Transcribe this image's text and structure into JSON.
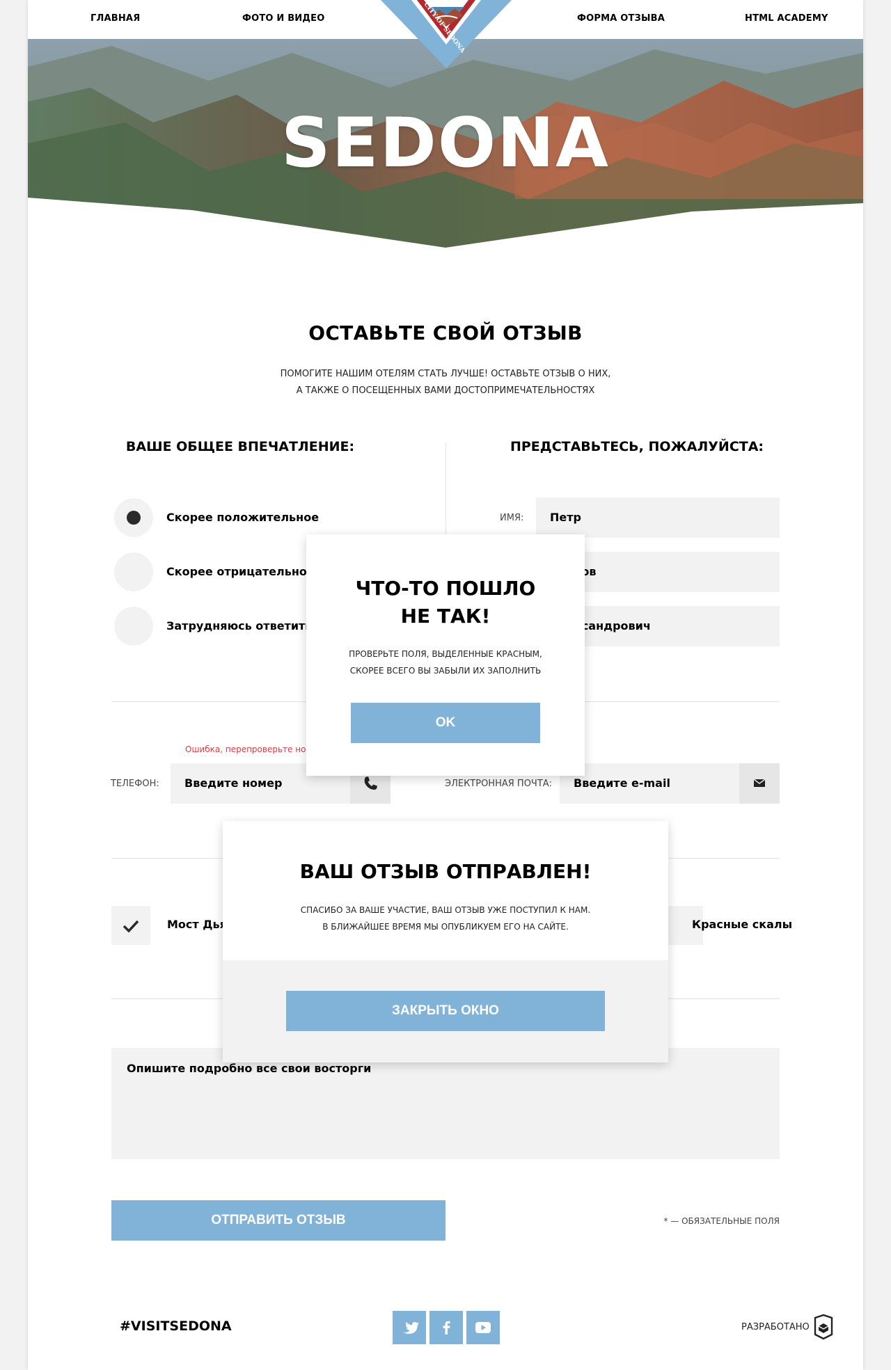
{
  "nav": {
    "items": [
      "ГЛАВНАЯ",
      "ФОТО И ВИДЕО",
      "ФОРМА ОТЗЫВА",
      "HTML ACADEMY"
    ],
    "logo_text": "CITY OF SEDONA"
  },
  "hero": {
    "title": "SEDONA"
  },
  "form": {
    "title": "ОСТАВЬТЕ СВОЙ ОТЗЫВ",
    "subtitle_line1": "ПОМОГИТЕ НАШИМ ОТЕЛЯМ СТАТЬ ЛУЧШЕ! ОСТАВЬТЕ ОТЗЫВ О НИХ,",
    "subtitle_line2": "А ТАКЖЕ О ПОСЕЩЕННЫХ ВАМИ ДОСТОПРИМЕЧАТЕЛЬНОСТЯХ",
    "impression": {
      "title": "ВАШЕ ОБЩЕЕ ВПЕЧАТЛЕНИЕ:",
      "options": [
        "Скорее положительное",
        "Скорее отрицательное",
        "Затрудняюсь ответить"
      ],
      "selected_index": 0
    },
    "intro": {
      "title": "ПРЕДСТАВЬТЕСЬ, ПОЖАЛУЙСТА:",
      "name_label": "ИМЯ:",
      "name_value": "Петр",
      "surname_value": "Иванов",
      "patronymic_value": "Александрович"
    },
    "contacts": {
      "error_text": "Ошибка, перепроверьте номер",
      "phone_label": "ТЕЛЕФОН:",
      "phone_placeholder": "Введите номер",
      "email_label": "ЭЛЕКТРОННАЯ ПОЧТА:",
      "email_placeholder": "Введите e-mail"
    },
    "places": {
      "options": [
        "Мост Дьявола",
        "Красные скалы"
      ],
      "checked": [
        true,
        false
      ]
    },
    "comment_placeholder": "Опишите подробно все свои восторги",
    "submit_label": "ОТПРАВИТЬ ОТЗЫВ",
    "required_note": "* — ОБЯЗАТЕЛЬНЫЕ ПОЛЯ"
  },
  "footer": {
    "hashtag": "#VISITSEDONA",
    "social": [
      "twitter-icon",
      "facebook-icon",
      "youtube-icon"
    ],
    "developed_label": "РАЗРАБОТАНО"
  },
  "modal_error": {
    "title_line1": "ЧТО-ТО ПОШЛО",
    "title_line2": "НЕ ТАК!",
    "text_line1": "ПРОВЕРЬТЕ ПОЛЯ, ВЫДЕЛЕННЫЕ КРАСНЫМ,",
    "text_line2": "СКОРЕЕ ВСЕГО ВЫ ЗАБЫЛИ ИХ ЗАПОЛНИТЬ",
    "button_label": "OK"
  },
  "modal_success": {
    "title": "ВАШ ОТЗЫВ ОТПРАВЛЕН!",
    "text_line1": "СПАСИБО ЗА ВАШЕ УЧАСТИЕ, ВАШ ОТЗЫВ УЖЕ ПОСТУПИЛ К НАМ.",
    "text_line2": "В БЛИЖАЙШЕЕ ВРЕМЯ МЫ ОПУБЛИКУЕМ ЕГО НА САЙТЕ.",
    "button_label": "ЗАКРЫТЬ ОКНО"
  },
  "colors": {
    "accent": "#80b3d7",
    "error": "#e53b3b",
    "field_bg": "#f2f2f2",
    "badge_blue": "#80b3d7",
    "badge_red": "#b2282e"
  }
}
